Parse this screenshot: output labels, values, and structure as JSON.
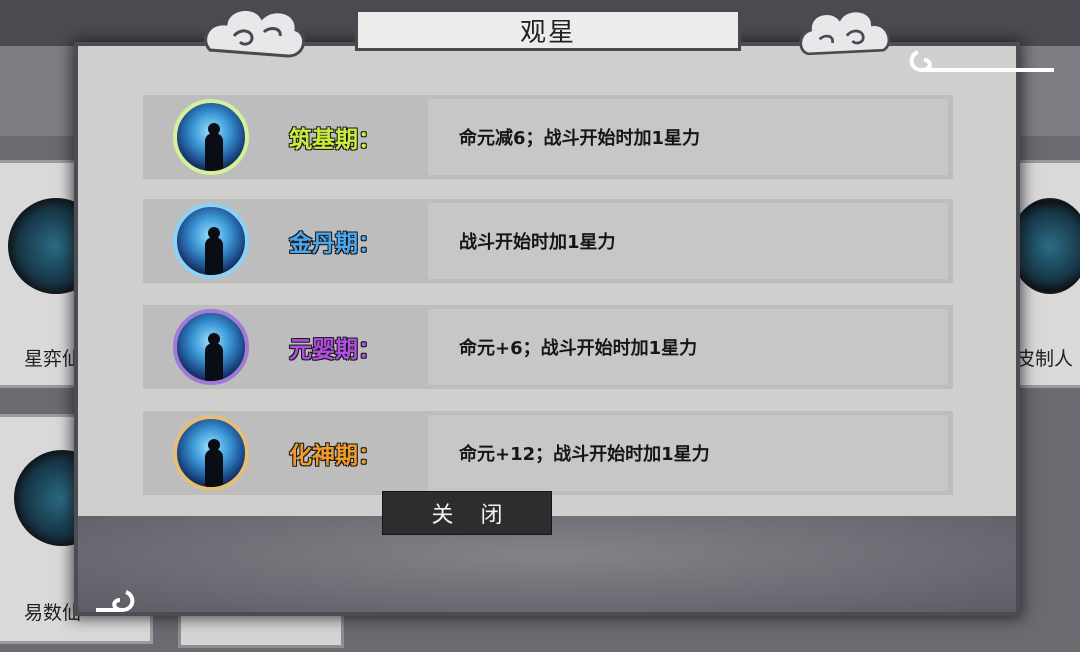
{
  "dialog": {
    "title": "观星",
    "close_label": "关 闭"
  },
  "stages": [
    {
      "name": "筑基期：",
      "color": "#c6ee3a",
      "ring": "#d6ef9a",
      "description": "命元减6；战斗开始时加1星力"
    },
    {
      "name": "金丹期：",
      "color": "#4aa7ee",
      "ring": "#8fd0f5",
      "description": "战斗开始时加1星力"
    },
    {
      "name": "元婴期：",
      "color": "#b24fe0",
      "ring": "#a17ad6",
      "description": "命元+6；战斗开始时加1星力"
    },
    {
      "name": "化神期：",
      "color": "#f09a2a",
      "ring": "#e6bd78",
      "description": "命元+12；战斗开始时加1星力"
    }
  ],
  "background": {
    "card_left_top_label": "星弈仙",
    "card_right_top_label": "皮制人",
    "card_left_bottom_label": "易数仙"
  }
}
